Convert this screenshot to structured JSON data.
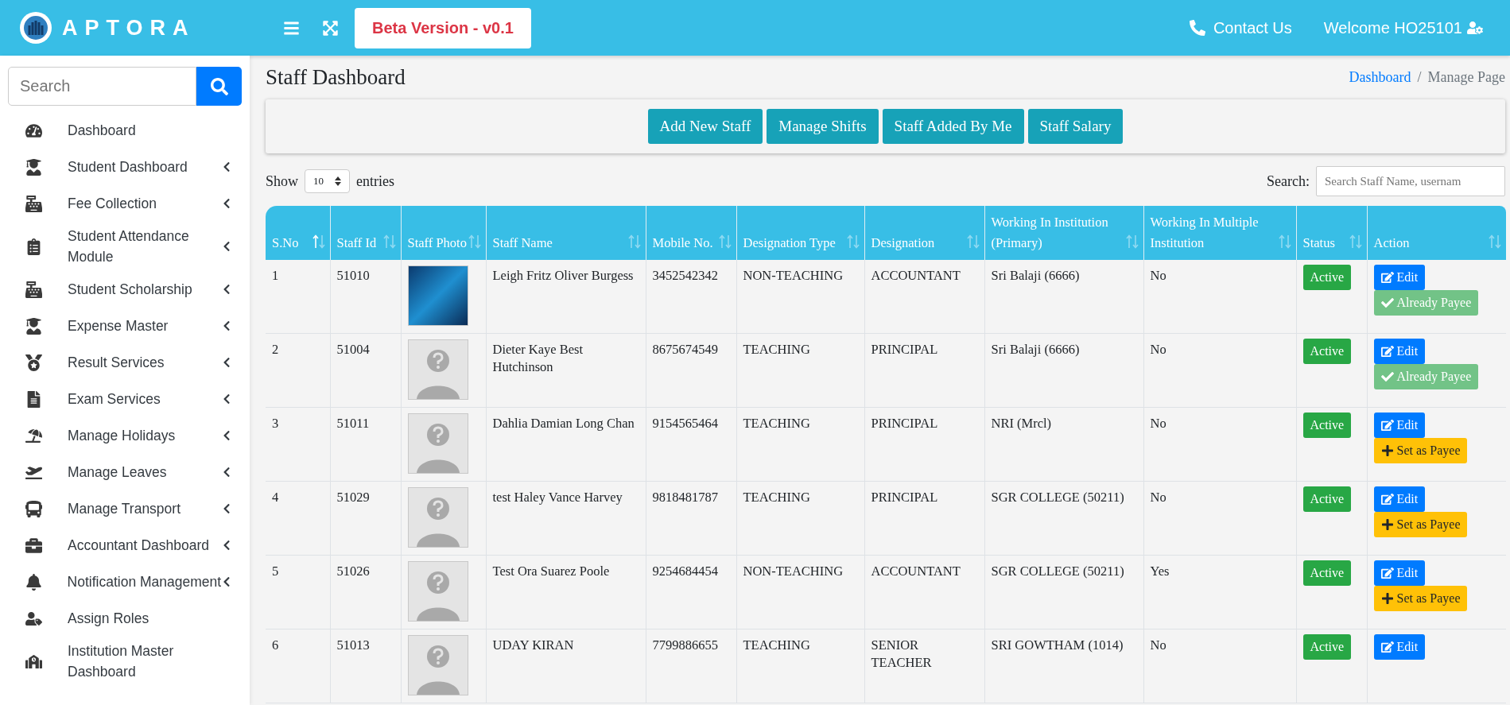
{
  "header": {
    "brand": "APTORA",
    "version_badge": "Beta Version - v0.1",
    "contact": "Contact Us",
    "welcome": "Welcome HO25101"
  },
  "sidebar": {
    "search_placeholder": "Search",
    "items": [
      {
        "label": "Dashboard",
        "has_submenu": false
      },
      {
        "label": "Student Dashboard",
        "has_submenu": true
      },
      {
        "label": "Fee Collection",
        "has_submenu": true
      },
      {
        "label": "Student Attendance Module",
        "has_submenu": true
      },
      {
        "label": "Student Scholarship",
        "has_submenu": true
      },
      {
        "label": "Expense Master",
        "has_submenu": true
      },
      {
        "label": "Result Services",
        "has_submenu": true
      },
      {
        "label": "Exam Services",
        "has_submenu": true
      },
      {
        "label": "Manage Holidays",
        "has_submenu": true
      },
      {
        "label": "Manage Leaves",
        "has_submenu": true
      },
      {
        "label": "Manage Transport",
        "has_submenu": true
      },
      {
        "label": "Accountant Dashboard",
        "has_submenu": true
      },
      {
        "label": "Notification Management",
        "has_submenu": true
      },
      {
        "label": "Assign Roles",
        "has_submenu": false
      },
      {
        "label": "Institution Master Dashboard",
        "has_submenu": false
      }
    ]
  },
  "page": {
    "title": "Staff Dashboard",
    "breadcrumb": {
      "link": "Dashboard",
      "separator": "/",
      "current": "Manage Page"
    },
    "action_buttons": [
      "Add New Staff",
      "Manage Shifts",
      "Staff Added By Me",
      "Staff Salary"
    ]
  },
  "table_controls": {
    "show_label": "Show",
    "page_size": "10",
    "entries_label": "entries",
    "search_label": "Search:",
    "search_placeholder": "Search Staff Name, usernam"
  },
  "table": {
    "columns": [
      {
        "label": "S.No",
        "sorted_ascending": true
      },
      {
        "label": "Staff Id",
        "sorted_ascending": false
      },
      {
        "label": "Staff Photo",
        "sorted_ascending": false
      },
      {
        "label": "Staff Name",
        "sorted_ascending": false
      },
      {
        "label": "Mobile No.",
        "sorted_ascending": false
      },
      {
        "label": "Designation Type",
        "sorted_ascending": false
      },
      {
        "label": "Designation",
        "sorted_ascending": false
      },
      {
        "label": "Working In Institution (Primary)",
        "sorted_ascending": false
      },
      {
        "label": "Working In Multiple Institution",
        "sorted_ascending": false
      },
      {
        "label": "Status",
        "sorted_ascending": false
      },
      {
        "label": "Action",
        "sorted_ascending": false
      }
    ],
    "rows": [
      {
        "sno": "1",
        "id": "51010",
        "has_photo": true,
        "name": "Leigh Fritz Oliver Burgess",
        "mobile": "3452542342",
        "type": "NON-TEACHING",
        "designation": "ACCOUNTANT",
        "institution": "Sri Balaji (6666)",
        "multiple": "No",
        "status": "Active",
        "edit": "Edit",
        "payee": {
          "kind": "already",
          "label": "Already Payee"
        }
      },
      {
        "sno": "2",
        "id": "51004",
        "has_photo": false,
        "name": "Dieter Kaye Best Hutchinson",
        "mobile": "8675674549",
        "type": "TEACHING",
        "designation": "PRINCIPAL",
        "institution": "Sri Balaji (6666)",
        "multiple": "No",
        "status": "Active",
        "edit": "Edit",
        "payee": {
          "kind": "already",
          "label": "Already Payee"
        }
      },
      {
        "sno": "3",
        "id": "51011",
        "has_photo": false,
        "name": "Dahlia Damian Long Chan",
        "mobile": "9154565464",
        "type": "TEACHING",
        "designation": "PRINCIPAL",
        "institution": "NRI (Mrcl)",
        "multiple": "No",
        "status": "Active",
        "edit": "Edit",
        "payee": {
          "kind": "set",
          "label": "Set as Payee"
        }
      },
      {
        "sno": "4",
        "id": "51029",
        "has_photo": false,
        "name": "test Haley Vance Harvey",
        "mobile": "9818481787",
        "type": "TEACHING",
        "designation": "PRINCIPAL",
        "institution": "SGR COLLEGE (50211)",
        "multiple": "No",
        "status": "Active",
        "edit": "Edit",
        "payee": {
          "kind": "set",
          "label": "Set as Payee"
        }
      },
      {
        "sno": "5",
        "id": "51026",
        "has_photo": false,
        "name": "Test Ora Suarez Poole",
        "mobile": "9254684454",
        "type": "NON-TEACHING",
        "designation": "ACCOUNTANT",
        "institution": "SGR COLLEGE (50211)",
        "multiple": "Yes",
        "status": "Active",
        "edit": "Edit",
        "payee": {
          "kind": "set",
          "label": "Set as Payee"
        }
      },
      {
        "sno": "6",
        "id": "51013",
        "has_photo": false,
        "name": "UDAY KIRAN",
        "mobile": "7799886655",
        "type": "TEACHING",
        "designation": "SENIOR TEACHER",
        "institution": "SRI GOWTHAM (1014)",
        "multiple": "No",
        "status": "Active",
        "edit": "Edit",
        "payee": {
          "kind": "none"
        }
      }
    ]
  }
}
